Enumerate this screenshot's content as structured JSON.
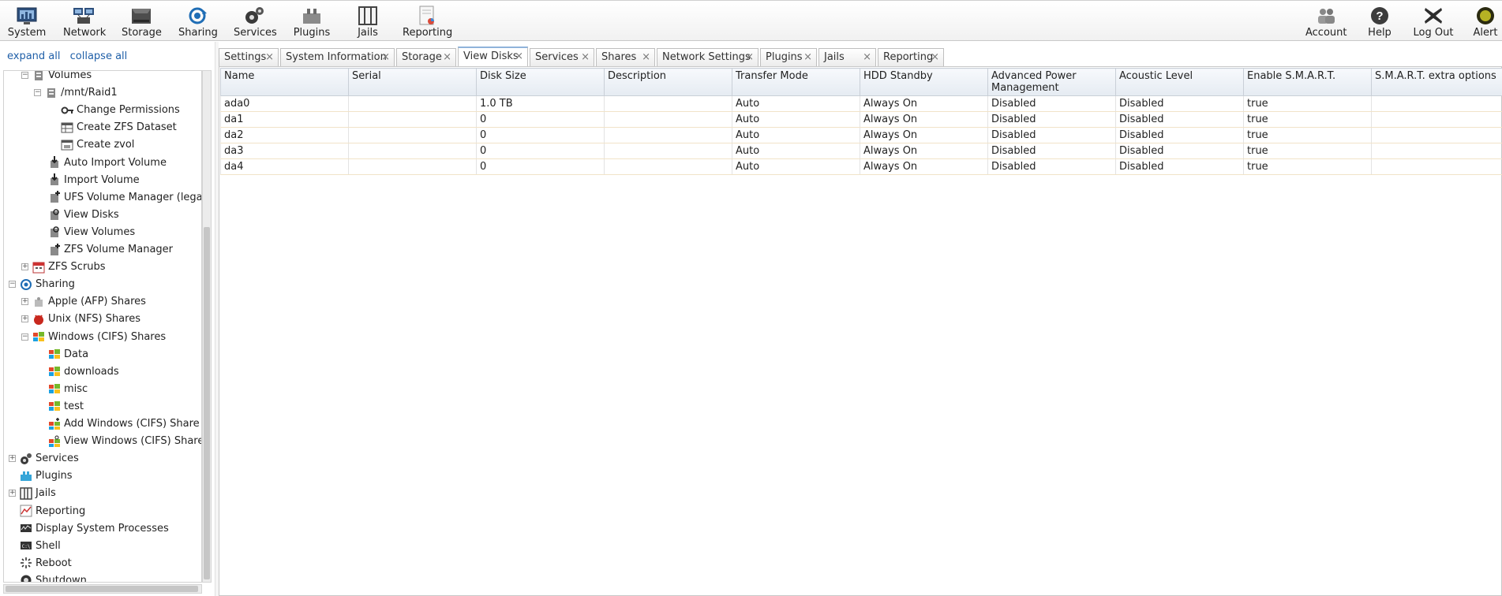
{
  "toolbar": {
    "left": [
      {
        "label": "System",
        "icon": "system-icon"
      },
      {
        "label": "Network",
        "icon": "network-icon"
      },
      {
        "label": "Storage",
        "icon": "storage-icon"
      },
      {
        "label": "Sharing",
        "icon": "sharing-icon"
      },
      {
        "label": "Services",
        "icon": "services-icon"
      },
      {
        "label": "Plugins",
        "icon": "plugins-icon"
      },
      {
        "label": "Jails",
        "icon": "jails-icon"
      },
      {
        "label": "Reporting",
        "icon": "reporting-icon"
      }
    ],
    "right": [
      {
        "label": "Account",
        "icon": "account-icon"
      },
      {
        "label": "Help",
        "icon": "help-icon"
      },
      {
        "label": "Log Out",
        "icon": "logout-icon"
      },
      {
        "label": "Alert",
        "icon": "alert-icon"
      }
    ]
  },
  "sidebar": {
    "expand_all": "expand all",
    "collapse_all": "collapse all",
    "tree": [
      {
        "label": "Volumes",
        "toggle": "-"
      },
      {
        "label": "/mnt/Raid1",
        "toggle": "-"
      },
      {
        "label": "Change Permissions",
        "toggle": ""
      },
      {
        "label": "Create ZFS Dataset",
        "toggle": ""
      },
      {
        "label": "Create zvol",
        "toggle": ""
      },
      {
        "label": "Auto Import Volume",
        "toggle": ""
      },
      {
        "label": "Import Volume",
        "toggle": ""
      },
      {
        "label": "UFS Volume Manager (legacy)",
        "toggle": ""
      },
      {
        "label": "View Disks",
        "toggle": ""
      },
      {
        "label": "View Volumes",
        "toggle": ""
      },
      {
        "label": "ZFS Volume Manager",
        "toggle": ""
      },
      {
        "label": "ZFS Scrubs",
        "toggle": "+"
      },
      {
        "label": "Sharing",
        "toggle": "-"
      },
      {
        "label": "Apple (AFP) Shares",
        "toggle": "+"
      },
      {
        "label": "Unix (NFS) Shares",
        "toggle": "+"
      },
      {
        "label": "Windows (CIFS) Shares",
        "toggle": "-"
      },
      {
        "label": "Data",
        "toggle": ""
      },
      {
        "label": "downloads",
        "toggle": ""
      },
      {
        "label": "misc",
        "toggle": ""
      },
      {
        "label": "test",
        "toggle": ""
      },
      {
        "label": "Add Windows (CIFS) Share",
        "toggle": ""
      },
      {
        "label": "View Windows (CIFS) Shares",
        "toggle": ""
      },
      {
        "label": "Services",
        "toggle": "+"
      },
      {
        "label": "Plugins",
        "toggle": ""
      },
      {
        "label": "Jails",
        "toggle": "+"
      },
      {
        "label": "Reporting",
        "toggle": ""
      },
      {
        "label": "Display System Processes",
        "toggle": ""
      },
      {
        "label": "Shell",
        "toggle": ""
      },
      {
        "label": "Reboot",
        "toggle": ""
      },
      {
        "label": "Shutdown",
        "toggle": ""
      }
    ]
  },
  "tabs": [
    {
      "label": "Settings"
    },
    {
      "label": "System Information"
    },
    {
      "label": "Storage"
    },
    {
      "label": "View Disks",
      "active": true
    },
    {
      "label": "Services"
    },
    {
      "label": "Shares"
    },
    {
      "label": "Network Settings"
    },
    {
      "label": "Plugins"
    },
    {
      "label": "Jails"
    },
    {
      "label": "Reporting"
    }
  ],
  "tab_close_glyph": "×",
  "table": {
    "columns": [
      "Name",
      "Serial",
      "Disk Size",
      "Description",
      "Transfer Mode",
      "HDD Standby",
      "Advanced Power Management",
      "Acoustic Level",
      "Enable S.M.A.R.T.",
      "S.M.A.R.T. extra options"
    ],
    "rows": [
      [
        "ada0",
        "",
        "1.0 TB",
        "",
        "Auto",
        "Always On",
        "Disabled",
        "Disabled",
        "true",
        ""
      ],
      [
        "da1",
        "",
        "0",
        "",
        "Auto",
        "Always On",
        "Disabled",
        "Disabled",
        "true",
        ""
      ],
      [
        "da2",
        "",
        "0",
        "",
        "Auto",
        "Always On",
        "Disabled",
        "Disabled",
        "true",
        ""
      ],
      [
        "da3",
        "",
        "0",
        "",
        "Auto",
        "Always On",
        "Disabled",
        "Disabled",
        "true",
        ""
      ],
      [
        "da4",
        "",
        "0",
        "",
        "Auto",
        "Always On",
        "Disabled",
        "Disabled",
        "true",
        ""
      ]
    ]
  }
}
